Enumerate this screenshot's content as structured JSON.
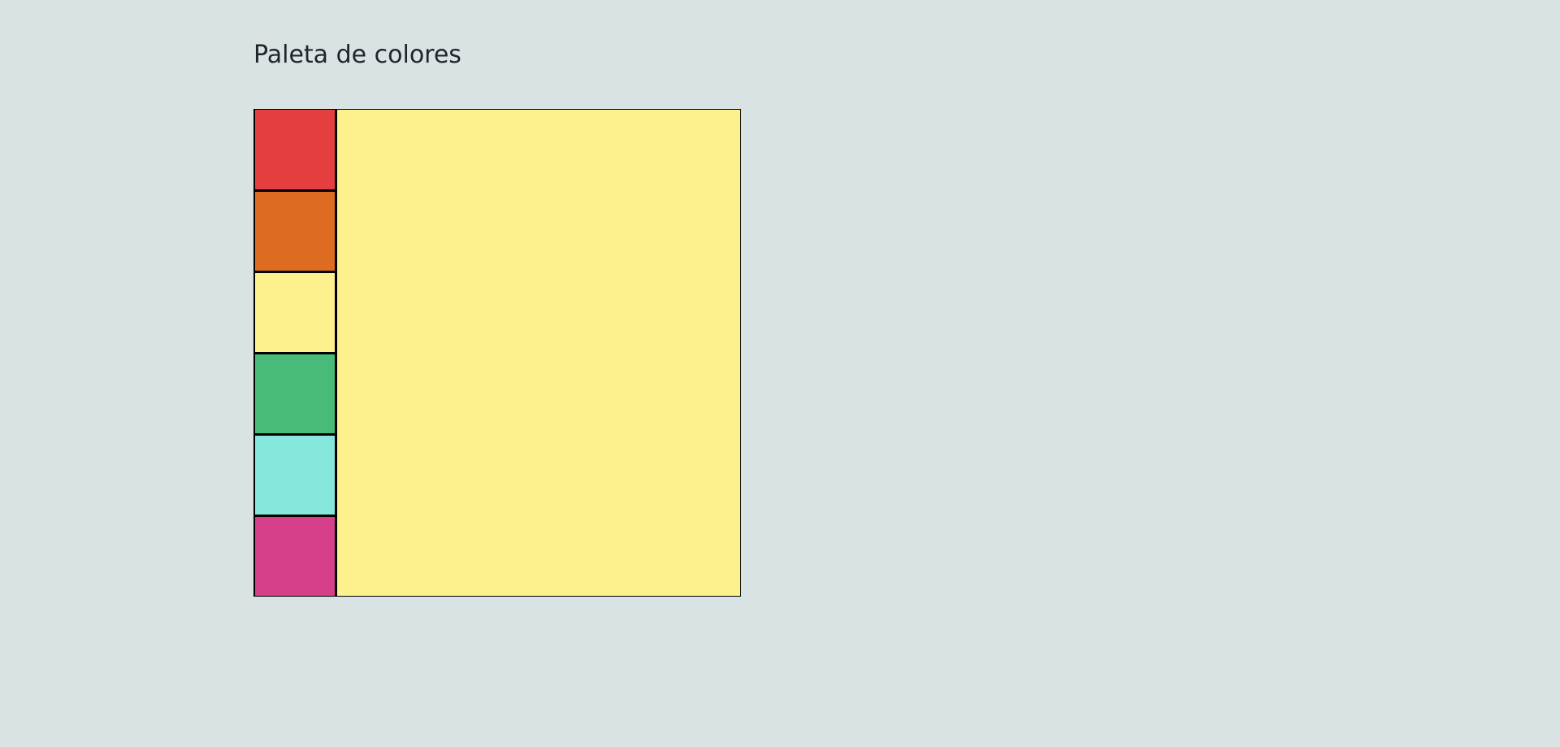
{
  "page": {
    "title": "Paleta de colores",
    "background_color": "#dae3e3"
  },
  "palette": {
    "selected_color": "#fcf18d",
    "swatches": [
      {
        "name": "red",
        "color": "#e53e3e"
      },
      {
        "name": "orange",
        "color": "#dd6b20"
      },
      {
        "name": "yellow",
        "color": "#fcf18d"
      },
      {
        "name": "green",
        "color": "#48bb78"
      },
      {
        "name": "teal",
        "color": "#86e8dc"
      },
      {
        "name": "pink",
        "color": "#d53f8c"
      }
    ]
  }
}
